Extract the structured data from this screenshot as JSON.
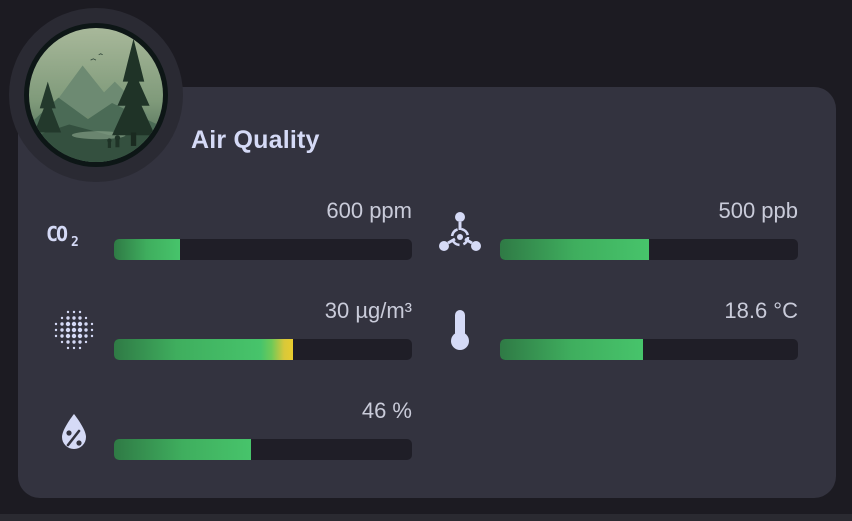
{
  "card": {
    "title": "Air Quality"
  },
  "sensors": [
    {
      "key": "co2",
      "icon": "co2-icon",
      "value": "600 ppm",
      "level": 0.22,
      "color": "green"
    },
    {
      "key": "voc",
      "icon": "molecule-icon",
      "value": "500 ppb",
      "level": 0.5,
      "color": "green"
    },
    {
      "key": "pm25",
      "icon": "particles-icon",
      "value": "30 µg/m³",
      "level": 0.6,
      "color": "green-yellow"
    },
    {
      "key": "temperature",
      "icon": "thermometer-icon",
      "value": "18.6 °C",
      "level": 0.48,
      "color": "green"
    },
    {
      "key": "humidity",
      "icon": "water-percent-icon",
      "value": "46 %",
      "level": 0.46,
      "color": "green"
    }
  ],
  "colors": {
    "background": "#1c1b22",
    "card": "#33333f",
    "title": "#d5daf6",
    "bar_track": "#1f1e27",
    "bar_green": "#47c46b",
    "bar_yellow": "#e9cc2e",
    "icon": "#d5daf6"
  }
}
